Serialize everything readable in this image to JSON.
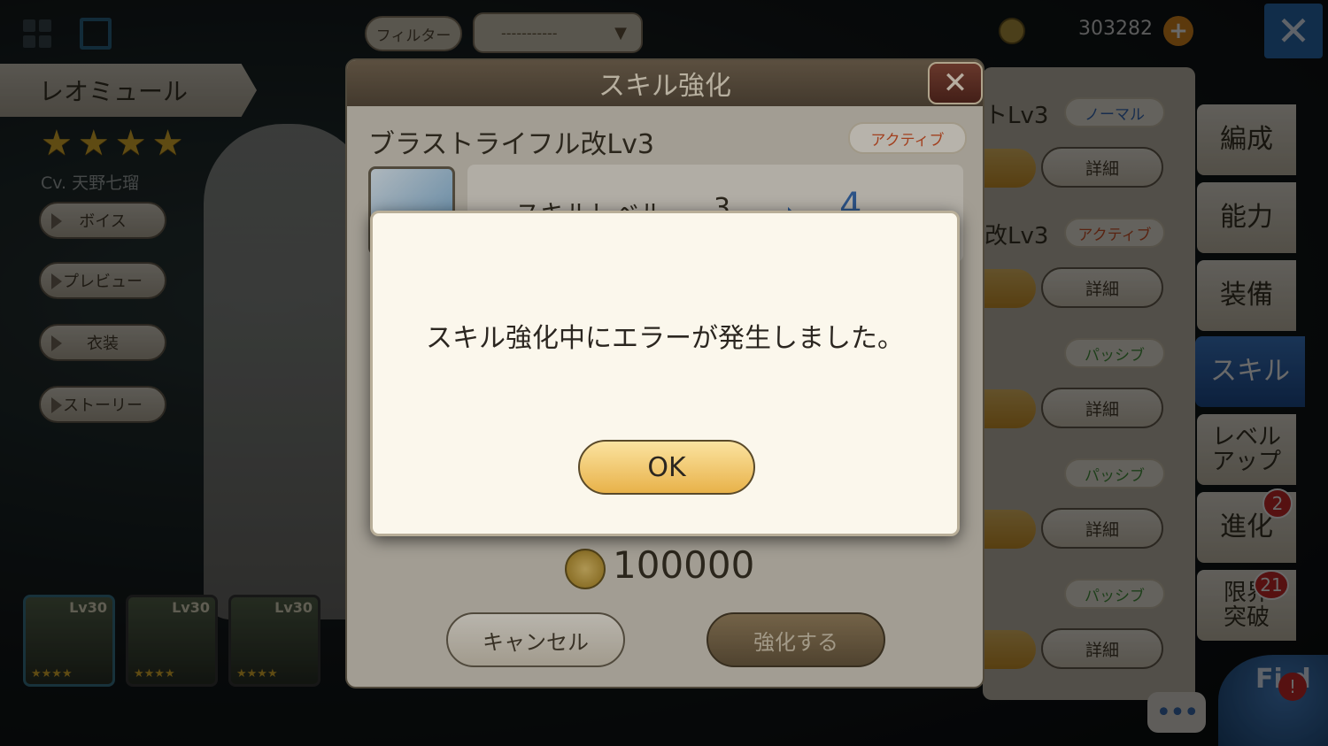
{
  "topbar": {
    "filter_label": "フィルター",
    "filter_value": "-----------",
    "currency_amount": "303282",
    "plus": "+",
    "close": "✕"
  },
  "character": {
    "name": "レオミュール",
    "stars": [
      "★",
      "★",
      "★",
      "★"
    ],
    "cv": "Cv. 天野七瑠",
    "buttons": [
      {
        "label": "ボイス"
      },
      {
        "label": "プレビュー"
      },
      {
        "label": "衣装"
      },
      {
        "label": "ストーリー"
      }
    ],
    "thumbnails": [
      {
        "level": "Lv30",
        "stars": "★★★★"
      },
      {
        "level": "Lv30",
        "stars": "★★★★"
      },
      {
        "level": "Lv30",
        "stars": "★★★★"
      }
    ]
  },
  "skills": {
    "rows": [
      {
        "name": "トLv3",
        "tag": "ノーマル",
        "detail": "詳細"
      },
      {
        "name": "改Lv3",
        "tag": "アクティブ",
        "detail": "詳細"
      },
      {
        "name": "",
        "tag": "パッシブ",
        "detail": "詳細"
      },
      {
        "name": "",
        "tag": "パッシブ",
        "detail": "詳細"
      },
      {
        "name": "",
        "tag": "パッシブ",
        "detail": "詳細"
      }
    ]
  },
  "tabs": [
    {
      "label": "編成"
    },
    {
      "label": "能力"
    },
    {
      "label": "装備"
    },
    {
      "label": "スキル"
    },
    {
      "label": "レベル\nアップ"
    },
    {
      "label": "進化",
      "badge": "2"
    },
    {
      "label": "限界\n突破",
      "badge": "21"
    }
  ],
  "chat": "•••",
  "field": {
    "label": "Fi d",
    "alert": "!"
  },
  "skill_dialog": {
    "title": "スキル強化",
    "close": "✕",
    "skill_name": "ブラストライフル改Lv3",
    "tag": "アクティブ",
    "level_label": "スキルレベル",
    "level_current": "3",
    "arrow": "➡",
    "level_next": "4",
    "cost": "100000",
    "cancel": "キャンセル",
    "enhance": "強化する"
  },
  "error_dialog": {
    "message": "スキル強化中にエラーが発生しました。",
    "ok": "OK"
  },
  "colors": {
    "accent_blue": "#2b6fb5",
    "gold": "#e8b24a",
    "active_tag": "#d9562a",
    "passive_tag": "#4a9a40",
    "normal_tag": "#3a6fbf"
  }
}
